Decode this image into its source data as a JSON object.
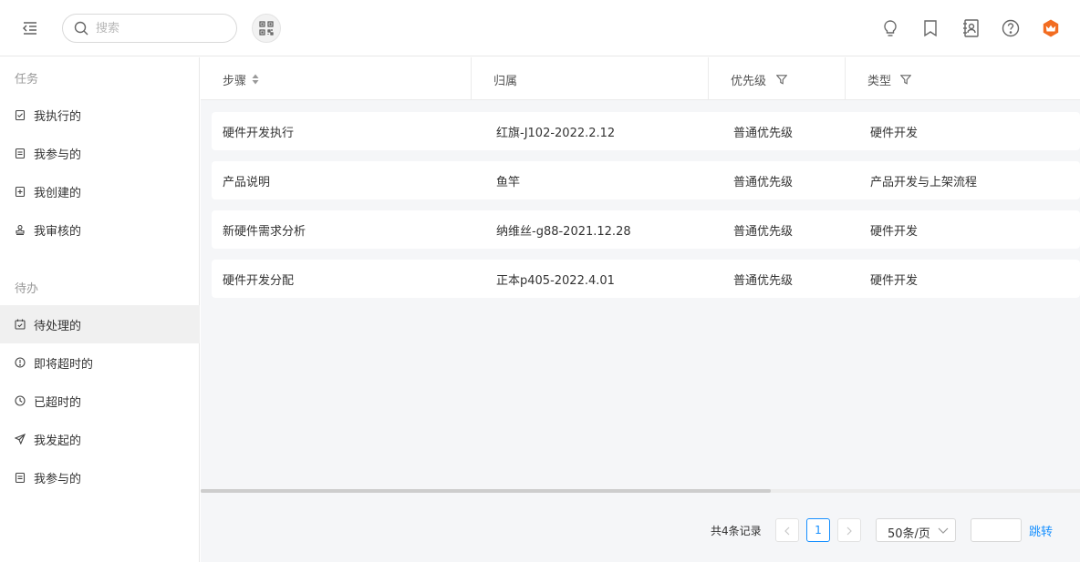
{
  "header": {
    "search_placeholder": "搜索"
  },
  "sidebar": {
    "section_tasks": "任务",
    "tasks": [
      {
        "label": "我执行的",
        "icon": "clipboard-check-icon"
      },
      {
        "label": "我参与的",
        "icon": "clipboard-list-icon"
      },
      {
        "label": "我创建的",
        "icon": "clipboard-plus-icon"
      },
      {
        "label": "我审核的",
        "icon": "stamp-icon"
      }
    ],
    "section_todo": "待办",
    "todos": [
      {
        "label": "待处理的",
        "icon": "calendar-check-icon",
        "active": true
      },
      {
        "label": "即将超时的",
        "icon": "alert-circle-icon"
      },
      {
        "label": "已超时的",
        "icon": "clock-icon"
      },
      {
        "label": "我发起的",
        "icon": "send-icon"
      },
      {
        "label": "我参与的",
        "icon": "clipboard-list-icon"
      }
    ]
  },
  "table": {
    "columns": [
      "步骤",
      "归属",
      "优先级",
      "类型"
    ],
    "rows": [
      [
        "硬件开发执行",
        "红旗-J102-2022.2.12",
        "普通优先级",
        "硬件开发"
      ],
      [
        "产品说明",
        "鱼竿",
        "普通优先级",
        "产品开发与上架流程"
      ],
      [
        "新硬件需求分析",
        "纳维丝-g88-2021.12.28",
        "普通优先级",
        "硬件开发"
      ],
      [
        "硬件开发分配",
        "正本p405-2022.4.01",
        "普通优先级",
        "硬件开发"
      ]
    ]
  },
  "pagination": {
    "total_text": "共4条记录",
    "current_page": "1",
    "page_size": "50条/页",
    "jump_label": "跳转"
  },
  "colors": {
    "accent": "#1890ff",
    "avatar": "#f26c21"
  }
}
